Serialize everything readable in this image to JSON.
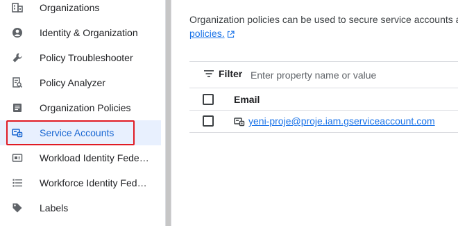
{
  "sidebar": {
    "items": [
      {
        "label": "Organizations",
        "icon": "organizations-icon"
      },
      {
        "label": "Identity & Organization",
        "icon": "account-circle-icon"
      },
      {
        "label": "Policy Troubleshooter",
        "icon": "wrench-icon"
      },
      {
        "label": "Policy Analyzer",
        "icon": "policy-analyzer-icon"
      },
      {
        "label": "Organization Policies",
        "icon": "document-list-icon"
      },
      {
        "label": "Service Accounts",
        "icon": "service-account-icon",
        "active": true
      },
      {
        "label": "Workload Identity Fede…",
        "icon": "id-card-icon"
      },
      {
        "label": "Workforce Identity Fed…",
        "icon": "list-icon"
      },
      {
        "label": "Labels",
        "icon": "tag-icon"
      }
    ]
  },
  "main": {
    "intro_text": "Organization policies can be used to secure service accounts a",
    "intro_link": "policies.",
    "filter": {
      "label": "Filter",
      "placeholder": "Enter property name or value"
    },
    "table": {
      "column_header": "Email",
      "rows": [
        {
          "email": "yeni-proje@proje.iam.gserviceaccount.com"
        }
      ]
    }
  },
  "colors": {
    "accent": "#1a73e8",
    "active_bg": "#e8f0fe",
    "highlight_border": "#e01b24"
  }
}
